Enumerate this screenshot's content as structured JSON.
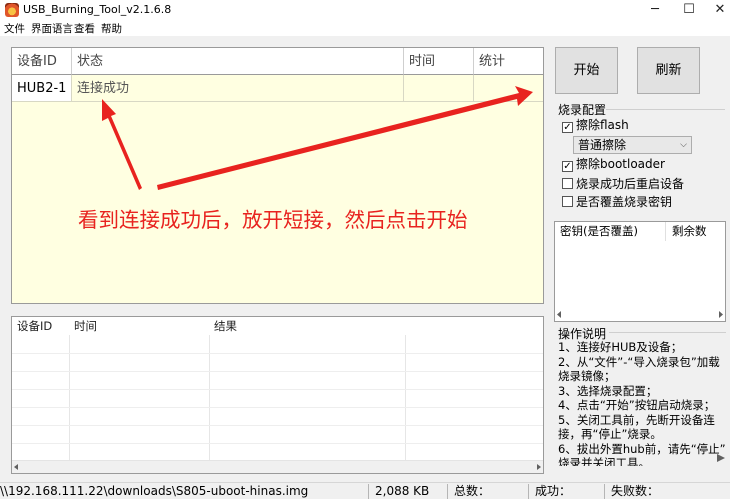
{
  "window": {
    "title": "USB_Burning_Tool_v2.1.6.8",
    "minimize": "─",
    "maximize": "☐",
    "close": "✕"
  },
  "menu": [
    "文件",
    "界面语言",
    "查看",
    "帮助"
  ],
  "device_table": {
    "columns": [
      "设备ID",
      "状态",
      "时间",
      "统计"
    ],
    "rows": [
      {
        "id": "HUB2-1",
        "status": "连接成功",
        "time": "",
        "stats": ""
      }
    ]
  },
  "log_table": {
    "columns": [
      "设备ID",
      "时间",
      "结果"
    ]
  },
  "buttons": {
    "start": "开始",
    "refresh": "刷新"
  },
  "burn_config": {
    "title": "烧录配置",
    "erase_flash": {
      "label": "擦除flash",
      "checked": true
    },
    "erase_mode": "普通擦除",
    "erase_bootloader": {
      "label": "擦除bootloader",
      "checked": true
    },
    "reboot_after": {
      "label": "烧录成功后重启设备",
      "checked": false
    },
    "overwrite_key": {
      "label": "是否覆盖烧录密钥",
      "checked": false
    }
  },
  "key_table": {
    "columns": [
      "密钥(是否覆盖)",
      "剩余数"
    ]
  },
  "instructions": {
    "title": "操作说明",
    "lines": [
      "1、连接好HUB及设备；",
      "2、从“文件”-“导入烧录包”加载",
      "烧录镜像；",
      "3、选择烧录配置；",
      "4、点击“开始”按钮启动烧录；",
      "5、关闭工具前，先断开设备连",
      "接，再“停止”烧录。",
      "6、拔出外置hub前，请先“停止”",
      "烧录并关闭工具。"
    ]
  },
  "status_bar": {
    "image_path": "\\\\192.168.111.22\\downloads\\S805-uboot-hinas.img",
    "size": "2,088 KB",
    "total_label": "总数：",
    "success_label": "成功：",
    "fail_label": "失败数："
  },
  "annotation": {
    "text": "看到连接成功后，放开短接，然后点击开始",
    "color": "#e8231f"
  }
}
